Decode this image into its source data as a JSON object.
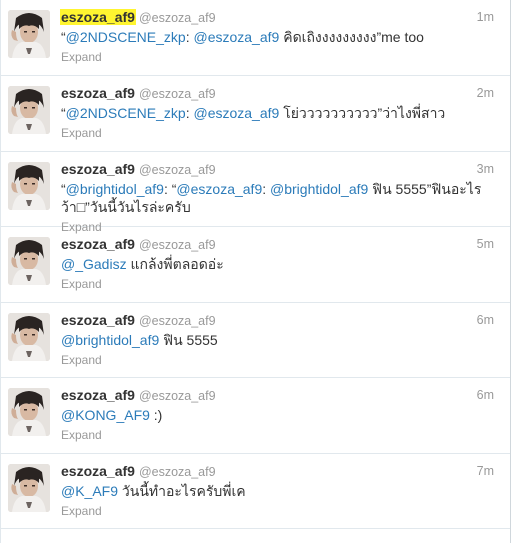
{
  "tweets": [
    {
      "fullname": "eszoza_af9",
      "highlight": true,
      "username": "@eszoza_af9",
      "time": "1m",
      "lines": [
        [
          {
            "t": "“",
            "link": false
          },
          {
            "t": "@2NDSCENE_zkp",
            "link": true
          },
          {
            "t": ": ",
            "link": false
          },
          {
            "t": "@eszoza_af9",
            "link": true
          },
          {
            "t": " คิดเถิงงงงงงงงง”me too",
            "link": false
          }
        ]
      ],
      "expand": "Expand"
    },
    {
      "fullname": "eszoza_af9",
      "highlight": false,
      "username": "@eszoza_af9",
      "time": "2m",
      "lines": [
        [
          {
            "t": "“",
            "link": false
          },
          {
            "t": "@2NDSCENE_zkp",
            "link": true
          },
          {
            "t": ": ",
            "link": false
          },
          {
            "t": "@eszoza_af9",
            "link": true
          },
          {
            "t": " โย่วววววววววว”ว่าไงพี่สาว",
            "link": false
          }
        ]
      ],
      "expand": "Expand"
    },
    {
      "fullname": "eszoza_af9",
      "highlight": false,
      "username": "@eszoza_af9",
      "time": "3m",
      "lines": [
        [
          {
            "t": "“",
            "link": false
          },
          {
            "t": "@brightidol_af9",
            "link": true
          },
          {
            "t": ": “",
            "link": false
          },
          {
            "t": "@eszoza_af9",
            "link": true
          },
          {
            "t": ": ",
            "link": false
          },
          {
            "t": "@brightidol_af9",
            "link": true
          },
          {
            "t": " ฟิน 5555”ฟินอะไร",
            "link": false
          }
        ],
        [
          {
            "t": "ว้า□”วันนี้วันไรล่ะครับ",
            "link": false
          }
        ]
      ],
      "expand": "Expand"
    },
    {
      "fullname": "eszoza_af9",
      "highlight": false,
      "username": "@eszoza_af9",
      "time": "5m",
      "lines": [
        [
          {
            "t": "@_Gadisz",
            "link": true
          },
          {
            "t": " แกล้งพี่ตลอดอ่ะ",
            "link": false
          }
        ]
      ],
      "expand": "Expand"
    },
    {
      "fullname": "eszoza_af9",
      "highlight": false,
      "username": "@eszoza_af9",
      "time": "6m",
      "lines": [
        [
          {
            "t": "@brightidol_af9",
            "link": true
          },
          {
            "t": " ฟิน 5555",
            "link": false
          }
        ]
      ],
      "expand": "Expand"
    },
    {
      "fullname": "eszoza_af9",
      "highlight": false,
      "username": "@eszoza_af9",
      "time": "6m",
      "lines": [
        [
          {
            "t": "@KONG_AF9",
            "link": true
          },
          {
            "t": " :)",
            "link": false
          }
        ]
      ],
      "expand": "Expand"
    },
    {
      "fullname": "eszoza_af9",
      "highlight": false,
      "username": "@eszoza_af9",
      "time": "7m",
      "lines": [
        [
          {
            "t": "@K_AF9",
            "link": true
          },
          {
            "t": " วันนี้ทำอะไรครับพี่เค",
            "link": false
          }
        ]
      ],
      "expand": "Expand"
    }
  ],
  "colors": {
    "link": "#2b7bb9",
    "highlight": "#fff530",
    "muted": "#999999",
    "text": "#333333",
    "divider": "#e1e8ed"
  },
  "icons": {
    "avatar": "user-avatar-photo"
  }
}
